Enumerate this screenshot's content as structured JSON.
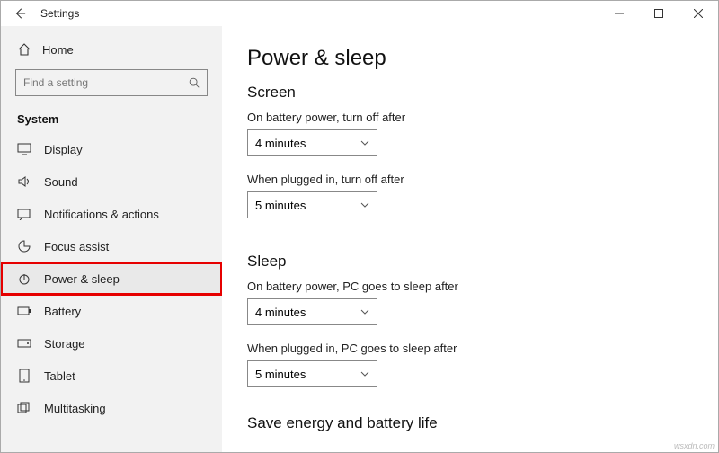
{
  "titlebar": {
    "app": "Settings"
  },
  "home": {
    "label": "Home"
  },
  "search": {
    "placeholder": "Find a setting"
  },
  "category": "System",
  "nav": [
    {
      "id": "display",
      "label": "Display"
    },
    {
      "id": "sound",
      "label": "Sound"
    },
    {
      "id": "notifications",
      "label": "Notifications & actions"
    },
    {
      "id": "focus",
      "label": "Focus assist"
    },
    {
      "id": "power",
      "label": "Power & sleep"
    },
    {
      "id": "battery",
      "label": "Battery"
    },
    {
      "id": "storage",
      "label": "Storage"
    },
    {
      "id": "tablet",
      "label": "Tablet"
    },
    {
      "id": "multitask",
      "label": "Multitasking"
    }
  ],
  "main": {
    "title": "Power & sleep",
    "screen": {
      "heading": "Screen",
      "battery_label": "On battery power, turn off after",
      "battery_value": "4 minutes",
      "plugged_label": "When plugged in, turn off after",
      "plugged_value": "5 minutes"
    },
    "sleep": {
      "heading": "Sleep",
      "battery_label": "On battery power, PC goes to sleep after",
      "battery_value": "4 minutes",
      "plugged_label": "When plugged in, PC goes to sleep after",
      "plugged_value": "5 minutes"
    },
    "save": {
      "heading": "Save energy and battery life"
    }
  },
  "watermark": "wsxdn.com"
}
